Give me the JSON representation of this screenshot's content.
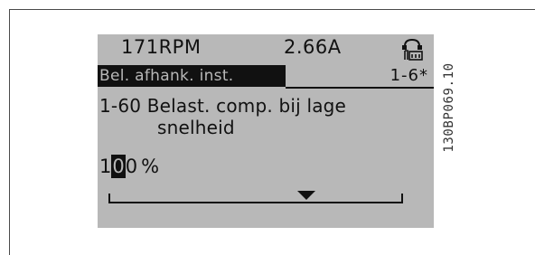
{
  "display": {
    "status": {
      "speed": "171RPM",
      "current": "2.66A",
      "handset_icon": "hand-keypad-icon"
    },
    "menu": {
      "title": "Bel. afhank. inst.",
      "index": "1-6*"
    },
    "parameter": {
      "line1": "1-60 Belast. comp. bij lage",
      "line2": "snelheid"
    },
    "value": {
      "digits": [
        "1",
        "0",
        "0"
      ],
      "cursor_index": 1,
      "unit": "%"
    },
    "slider": {
      "pointer_icon": "triangle-down-icon"
    }
  },
  "figure_code": "130BP069.10",
  "colors": {
    "lcd_background": "#b8b8b8",
    "lcd_foreground": "#111111",
    "frame": "#4a4a4a"
  }
}
